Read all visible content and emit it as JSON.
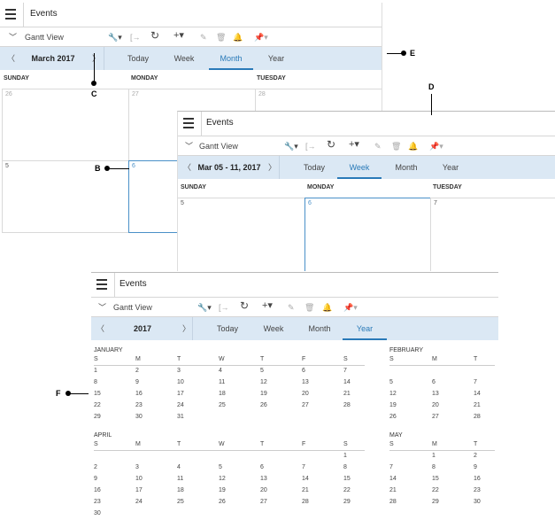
{
  "panel_month": {
    "title": "Events",
    "view": "Gantt View",
    "period": "March 2017",
    "tabs": [
      "Today",
      "Week",
      "Month",
      "Year"
    ],
    "active_tab": "Month",
    "days": [
      "SUNDAY",
      "MONDAY",
      "TUESDAY"
    ],
    "week1": [
      "26",
      "27",
      "28"
    ],
    "week2": [
      "5",
      "6",
      ""
    ]
  },
  "panel_week": {
    "title": "Events",
    "view": "Gantt View",
    "period": "Mar 05 - 11, 2017",
    "tabs": [
      "Today",
      "Week",
      "Month",
      "Year"
    ],
    "active_tab": "Week",
    "days": [
      "SUNDAY",
      "MONDAY",
      "TUESDAY"
    ],
    "dates": [
      "5",
      "6",
      "7"
    ]
  },
  "panel_year": {
    "title": "Events",
    "view": "Gantt View",
    "period": "2017",
    "tabs": [
      "Today",
      "Week",
      "Month",
      "Year"
    ],
    "active_tab": "Year",
    "weekday_headers": [
      "S",
      "M",
      "T",
      "W",
      "T",
      "F",
      "S"
    ],
    "months": [
      {
        "name": "JANUARY",
        "rows": [
          [
            "1",
            "2",
            "3",
            "4",
            "5",
            "6",
            "7"
          ],
          [
            "8",
            "9",
            "10",
            "11",
            "12",
            "13",
            "14"
          ],
          [
            "15",
            "16",
            "17",
            "18",
            "19",
            "20",
            "21"
          ],
          [
            "22",
            "23",
            "24",
            "25",
            "26",
            "27",
            "28"
          ],
          [
            "29",
            "30",
            "31",
            "",
            "",
            "",
            ""
          ]
        ]
      },
      {
        "name": "FEBRUARY",
        "headers": [
          "S",
          "M",
          "T"
        ],
        "rows": [
          [
            "",
            "",
            ""
          ],
          [
            "5",
            "6",
            "7"
          ],
          [
            "12",
            "13",
            "14"
          ],
          [
            "19",
            "20",
            "21"
          ],
          [
            "26",
            "27",
            "28"
          ]
        ]
      },
      {
        "name": "APRIL",
        "rows": [
          [
            "",
            "",
            "",
            "",
            "",
            "",
            "1"
          ],
          [
            "2",
            "3",
            "4",
            "5",
            "6",
            "7",
            "8"
          ],
          [
            "9",
            "10",
            "11",
            "12",
            "13",
            "14",
            "15"
          ],
          [
            "16",
            "17",
            "18",
            "19",
            "20",
            "21",
            "22"
          ],
          [
            "23",
            "24",
            "25",
            "26",
            "27",
            "28",
            "29"
          ],
          [
            "30",
            "",
            "",
            "",
            "",
            "",
            ""
          ]
        ]
      },
      {
        "name": "MAY",
        "headers": [
          "S",
          "M",
          "T"
        ],
        "rows": [
          [
            "",
            "1",
            "2"
          ],
          [
            "7",
            "8",
            "9"
          ],
          [
            "14",
            "15",
            "16"
          ],
          [
            "21",
            "22",
            "23"
          ],
          [
            "28",
            "29",
            "30"
          ]
        ]
      }
    ]
  },
  "callouts": {
    "B": "B",
    "C": "C",
    "D": "D",
    "E": "E",
    "F": "F"
  },
  "colors": {
    "nav_bg": "#dbe8f4",
    "accent": "#2a7ab8"
  }
}
